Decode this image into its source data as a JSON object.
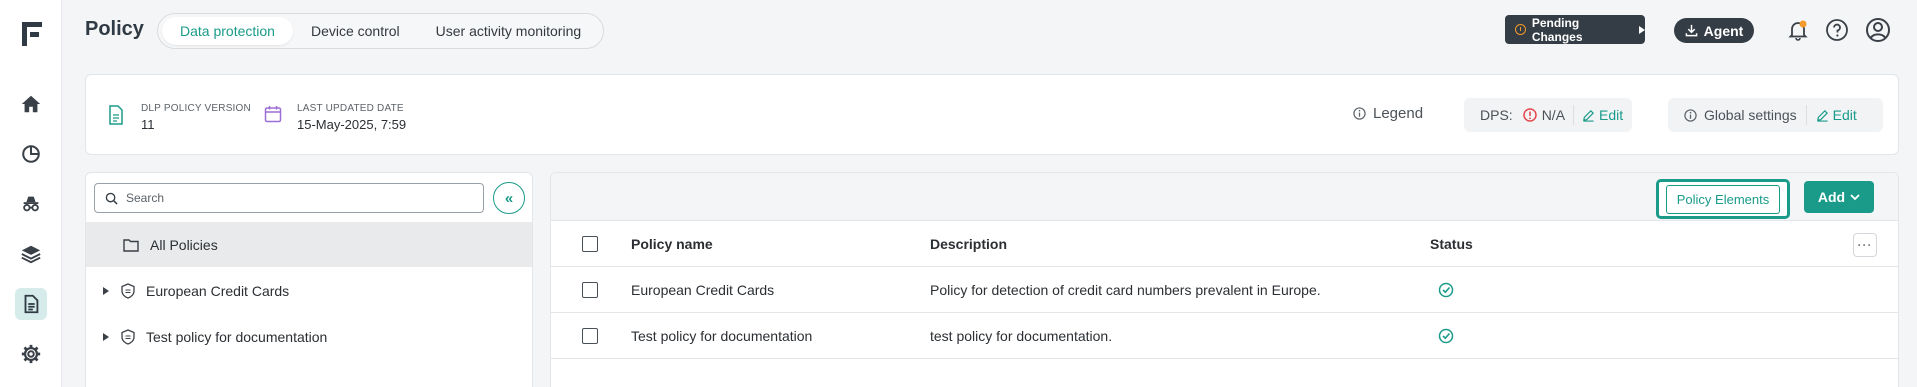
{
  "header": {
    "title": "Policy",
    "tabs": [
      {
        "label": "Data protection",
        "active": true
      },
      {
        "label": "Device control",
        "active": false
      },
      {
        "label": "User activity monitoring",
        "active": false
      }
    ],
    "pending_changes_label": "Pending Changes",
    "agent_label": "Agent"
  },
  "info": {
    "version_label": "DLP POLICY VERSION",
    "version_value": "11",
    "updated_label": "LAST UPDATED DATE",
    "updated_value": "15-May-2025, 7:59",
    "legend_label": "Legend",
    "dps_label": "DPS:",
    "dps_value": "N/A",
    "dps_edit_label": "Edit",
    "global_settings_label": "Global settings",
    "global_edit_label": "Edit"
  },
  "left_panel": {
    "search_placeholder": "Search",
    "tree": [
      {
        "label": "All Policies"
      },
      {
        "label": "European Credit Cards"
      },
      {
        "label": "Test policy for documentation"
      }
    ]
  },
  "right_panel": {
    "policy_elements_label": "Policy Elements",
    "add_label": "Add",
    "columns": {
      "name": "Policy name",
      "description": "Description",
      "status": "Status"
    },
    "rows": [
      {
        "name": "European Credit Cards",
        "description": "Policy for detection of credit card numbers prevalent in Europe.",
        "status": "enabled"
      },
      {
        "name": "Test policy for documentation",
        "description": "test policy for documentation.",
        "status": "enabled"
      }
    ],
    "more_label": "···"
  },
  "colors": {
    "accent": "#1a9b8a",
    "dark_button": "#343c45",
    "warning": "#f39a2a",
    "error": "#e5484d"
  }
}
